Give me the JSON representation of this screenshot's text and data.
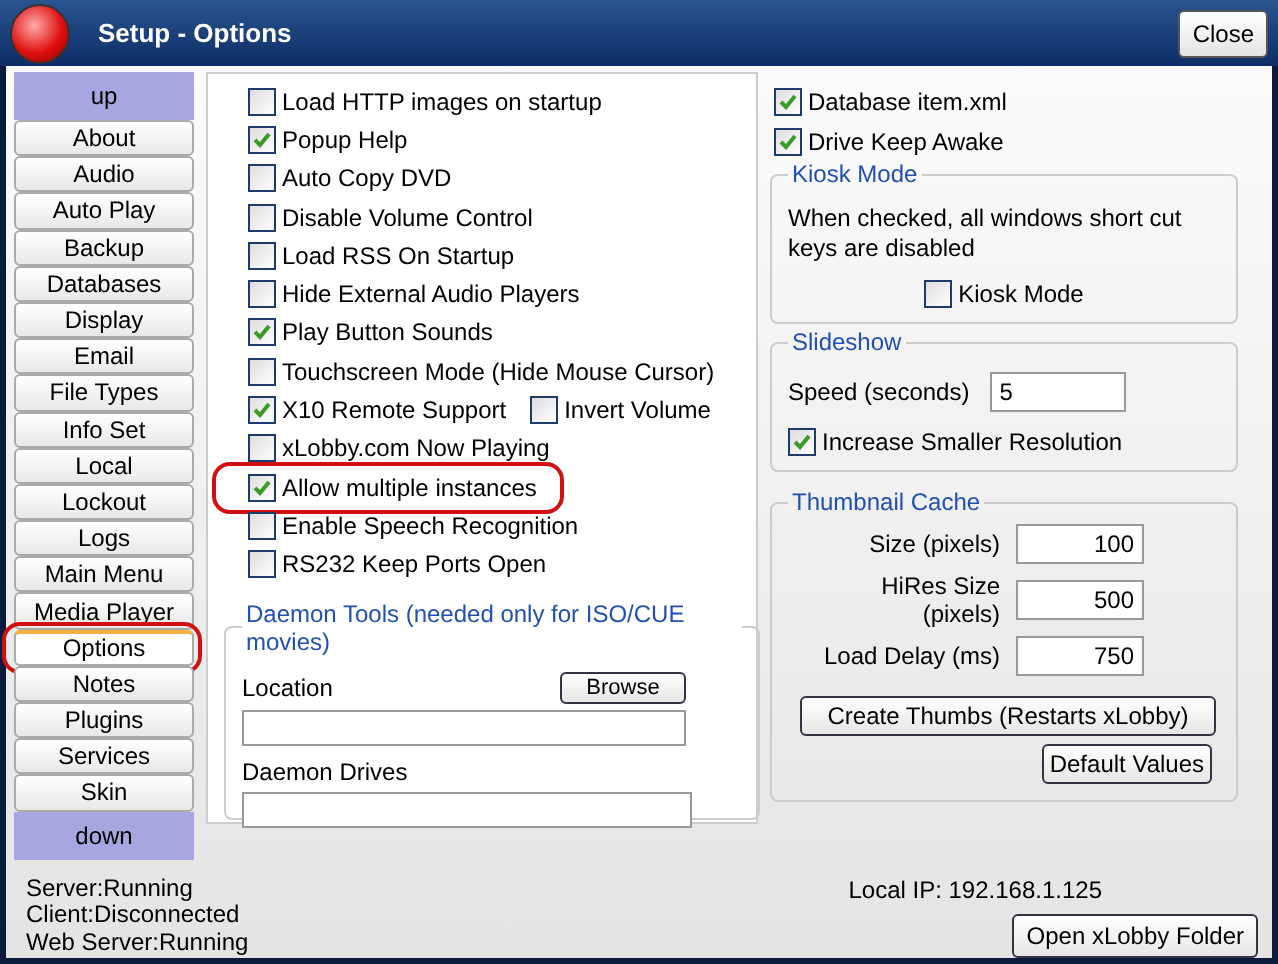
{
  "window": {
    "title": "Setup - Options",
    "close_button": "Close"
  },
  "sidebar": {
    "up": "up",
    "down": "down",
    "items": [
      {
        "label": "About",
        "selected": false,
        "highlighted": false
      },
      {
        "label": "Audio",
        "selected": false,
        "highlighted": false
      },
      {
        "label": "Auto Play",
        "selected": false,
        "highlighted": false
      },
      {
        "label": "Backup",
        "selected": false,
        "highlighted": false
      },
      {
        "label": "Databases",
        "selected": false,
        "highlighted": false
      },
      {
        "label": "Display",
        "selected": false,
        "highlighted": false
      },
      {
        "label": "Email",
        "selected": false,
        "highlighted": false
      },
      {
        "label": "File Types",
        "selected": false,
        "highlighted": false
      },
      {
        "label": "Info Set",
        "selected": false,
        "highlighted": false
      },
      {
        "label": "Local",
        "selected": false,
        "highlighted": false
      },
      {
        "label": "Lockout",
        "selected": false,
        "highlighted": false
      },
      {
        "label": "Logs",
        "selected": false,
        "highlighted": false
      },
      {
        "label": "Main Menu",
        "selected": false,
        "highlighted": false
      },
      {
        "label": "Media Player",
        "selected": false,
        "highlighted": false
      },
      {
        "label": "Options",
        "selected": true,
        "highlighted": true
      },
      {
        "label": "Notes",
        "selected": false,
        "highlighted": false
      },
      {
        "label": "Plugins",
        "selected": false,
        "highlighted": false
      },
      {
        "label": "Services",
        "selected": false,
        "highlighted": false
      },
      {
        "label": "Skin",
        "selected": false,
        "highlighted": false
      }
    ]
  },
  "options": [
    [
      {
        "label": "Load HTTP images on startup",
        "checked": false,
        "highlighted": false
      }
    ],
    [
      {
        "label": "Popup Help",
        "checked": true,
        "highlighted": false
      }
    ],
    [
      {
        "label": "Auto Copy DVD",
        "checked": false,
        "highlighted": false
      }
    ],
    [
      {
        "label": "Disable Volume Control",
        "checked": false,
        "highlighted": false
      }
    ],
    [
      {
        "label": "Load RSS On Startup",
        "checked": false,
        "highlighted": false
      }
    ],
    [
      {
        "label": "Hide External Audio Players",
        "checked": false,
        "highlighted": false
      }
    ],
    [
      {
        "label": "Play Button Sounds",
        "checked": true,
        "highlighted": false
      }
    ],
    [
      {
        "label": "Touchscreen Mode (Hide Mouse Cursor)",
        "checked": false,
        "highlighted": false
      }
    ],
    [
      {
        "label": "X10 Remote Support",
        "checked": true,
        "highlighted": false
      },
      {
        "label": "Invert Volume",
        "checked": false,
        "highlighted": false
      }
    ],
    [
      {
        "label": "xLobby.com Now Playing",
        "checked": false,
        "highlighted": false
      }
    ],
    [
      {
        "label": "Allow multiple instances",
        "checked": true,
        "highlighted": true
      }
    ],
    [
      {
        "label": "Enable Speech Recognition",
        "checked": false,
        "highlighted": false
      }
    ],
    [
      {
        "label": "RS232 Keep Ports Open",
        "checked": false,
        "highlighted": false
      }
    ]
  ],
  "daemon_tools": {
    "title": "Daemon Tools (needed only for ISO/CUE movies)",
    "location_label": "Location",
    "browse_button": "Browse",
    "drives_label": "Daemon Drives"
  },
  "right_options": [
    {
      "label": "Database item.xml",
      "checked": true
    },
    {
      "label": "Drive Keep Awake",
      "checked": true
    }
  ],
  "kiosk": {
    "title": "Kiosk Mode",
    "description": "When checked, all windows short cut keys are disabled",
    "checkbox": {
      "label": "Kiosk Mode",
      "checked": false
    }
  },
  "slideshow": {
    "title": "Slideshow",
    "speed_label": "Speed (seconds)",
    "speed_value": "5",
    "checkbox": {
      "label": "Increase Smaller Resolution",
      "checked": true
    }
  },
  "thumbnail_cache": {
    "title": "Thumbnail Cache",
    "fields": [
      {
        "label": "Size (pixels)",
        "value": "100"
      },
      {
        "label": "HiRes Size (pixels)",
        "value": "500"
      },
      {
        "label": "Load Delay (ms)",
        "value": "750"
      }
    ],
    "create_button": "Create Thumbs (Restarts xLobby)",
    "default_button": "Default Values"
  },
  "status": [
    "Server:Running",
    "Client:Disconnected",
    "Web Server:Running"
  ],
  "local_ip": "Local IP: 192.168.1.125",
  "open_folder_button": "Open xLobby Folder"
}
